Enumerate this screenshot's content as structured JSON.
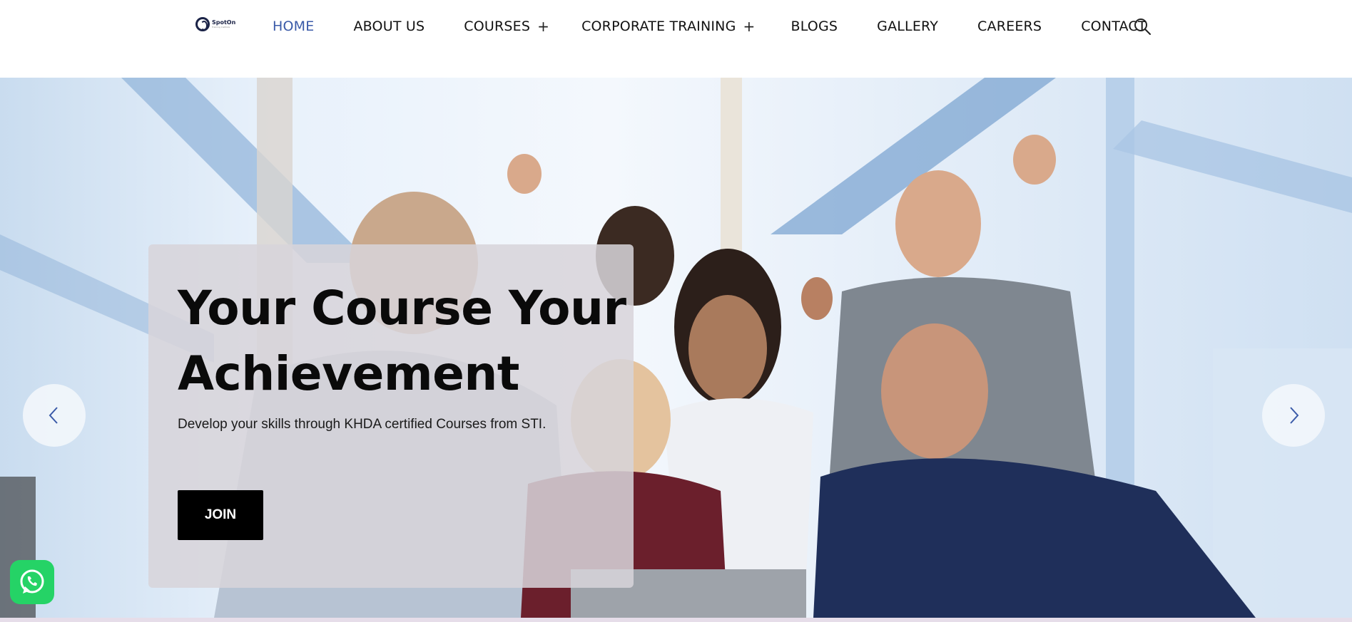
{
  "brand": {
    "logo_text": "SpotOn",
    "logo_sub": "Training Institute"
  },
  "nav": {
    "items": [
      {
        "label": "HOME",
        "active": true,
        "has_submenu": false
      },
      {
        "label": "ABOUT US",
        "active": false,
        "has_submenu": false
      },
      {
        "label": "COURSES",
        "active": false,
        "has_submenu": true
      },
      {
        "label": "CORPORATE TRAINING",
        "active": false,
        "has_submenu": true
      },
      {
        "label": "BLOGS",
        "active": false,
        "has_submenu": false
      },
      {
        "label": "GALLERY",
        "active": false,
        "has_submenu": false
      },
      {
        "label": "CAREERS",
        "active": false,
        "has_submenu": false
      },
      {
        "label": "CONTACT",
        "active": false,
        "has_submenu": false
      }
    ],
    "submenu_glyph": "+",
    "search_icon": "search-icon"
  },
  "hero": {
    "title_line1": "Your Course Your",
    "title_line2": "Achievement",
    "subtitle": "Develop your skills through KHDA certified Courses from STI.",
    "cta_label": "JOIN",
    "prev_icon": "chevron-left-icon",
    "next_icon": "chevron-right-icon"
  },
  "widgets": {
    "whatsapp_icon": "whatsapp-icon"
  },
  "colors": {
    "active_nav": "#3a5aa8",
    "cta_bg": "#000000",
    "whatsapp": "#25d366"
  }
}
